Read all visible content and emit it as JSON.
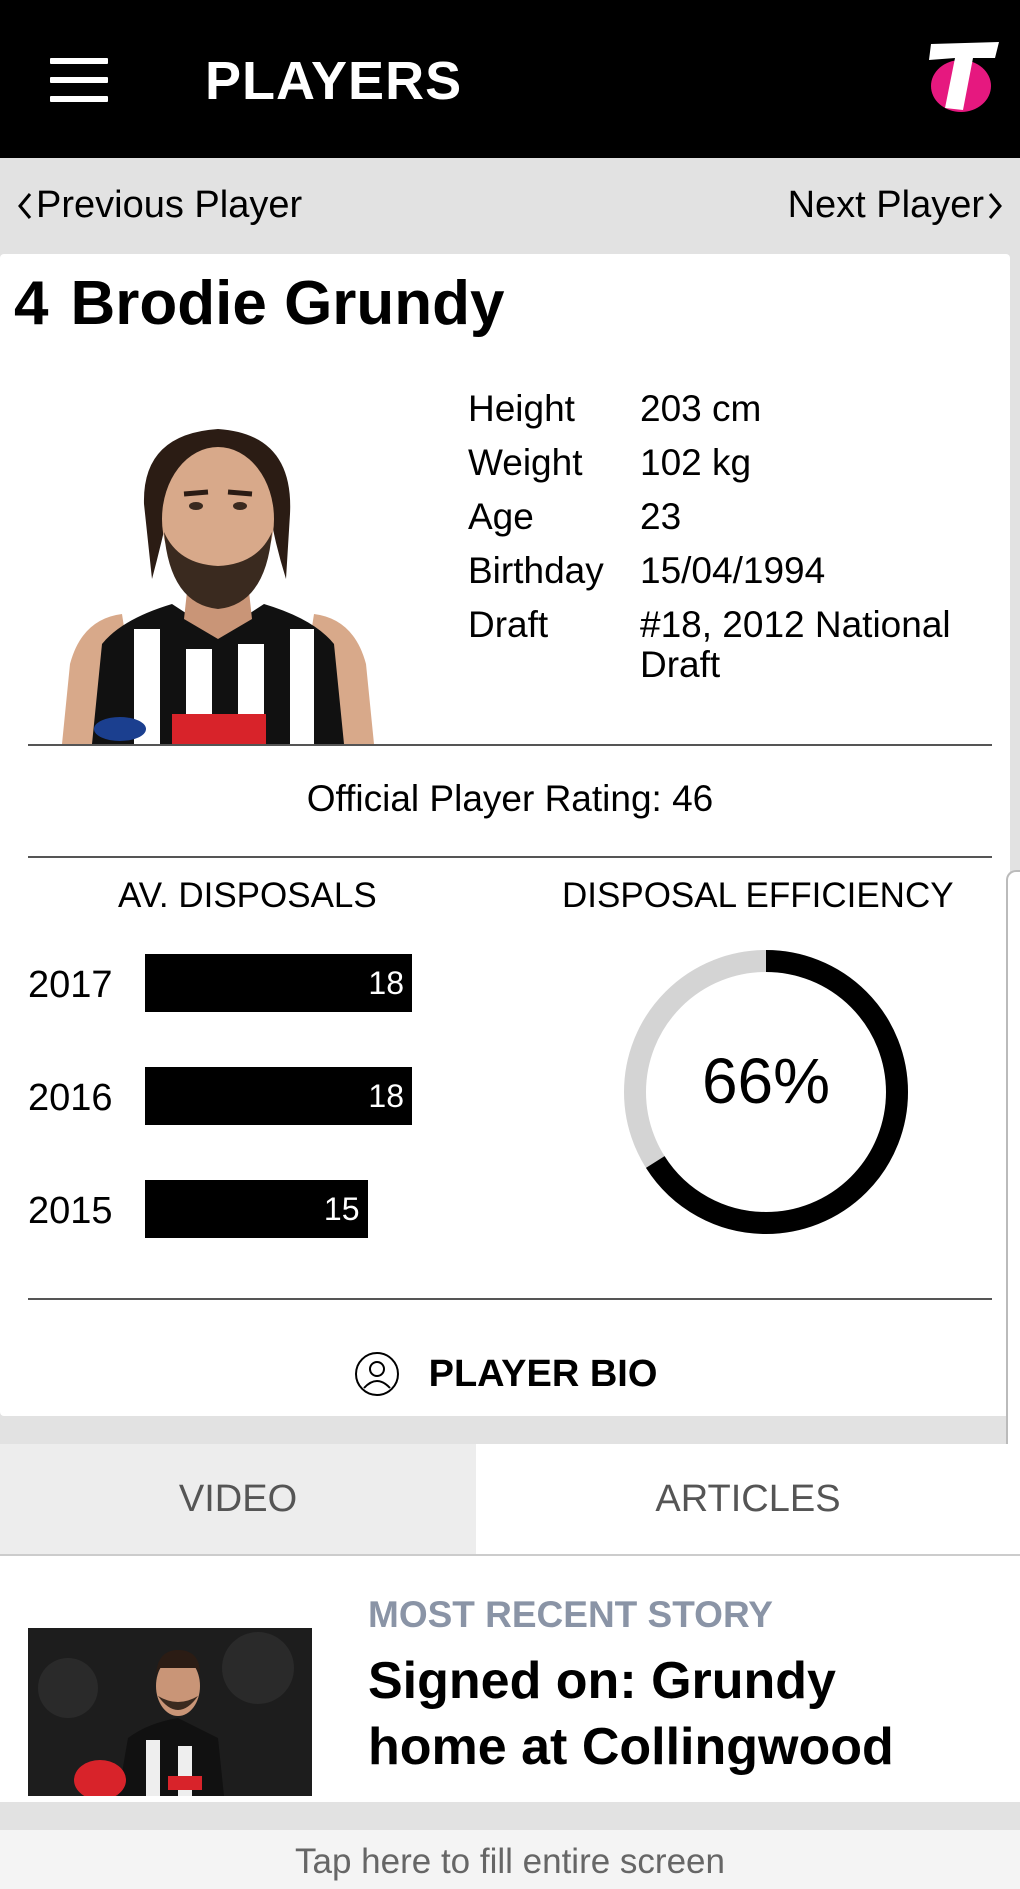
{
  "header": {
    "title": "PLAYERS"
  },
  "nav": {
    "prev_label": "Previous Player",
    "next_label": "Next Player"
  },
  "player": {
    "number": "4",
    "name": "Brodie Grundy",
    "details": [
      {
        "label": "Height",
        "value": "203 cm"
      },
      {
        "label": "Weight",
        "value": "102 kg"
      },
      {
        "label": "Age",
        "value": "23"
      },
      {
        "label": "Birthday",
        "value": "15/04/1994"
      },
      {
        "label": "Draft",
        "value": "#18, 2012 National Draft"
      }
    ],
    "rating_label": "Official Player Rating:",
    "rating_value": "46"
  },
  "stats": {
    "disposals_heading": "AV. DISPOSALS",
    "efficiency_heading": "DISPOSAL EFFICIENCY",
    "efficiency_label": "66%"
  },
  "chart_data": [
    {
      "type": "bar",
      "title": "AV. DISPOSALS",
      "orientation": "horizontal",
      "categories": [
        "2017",
        "2016",
        "2015"
      ],
      "values": [
        18,
        18,
        15
      ],
      "xlim": [
        0,
        18
      ],
      "color": "#000000"
    },
    {
      "type": "pie",
      "title": "DISPOSAL EFFICIENCY",
      "values": [
        66,
        34
      ],
      "colors": [
        "#000000",
        "#d4d4d4"
      ],
      "donut": true
    }
  ],
  "bio": {
    "label": "PLAYER BIO"
  },
  "tabs": [
    {
      "label": "VIDEO",
      "active": true
    },
    {
      "label": "ARTICLES",
      "active": false
    }
  ],
  "story": {
    "kicker": "MOST RECENT STORY",
    "title": "Signed on: Grundy home at Collingwood"
  },
  "footer": {
    "tap_label": "Tap here to fill entire screen"
  },
  "colors": {
    "header_bg": "#000000",
    "accent_pink": "#e6187f",
    "kicker_gray": "#8a94a6"
  }
}
